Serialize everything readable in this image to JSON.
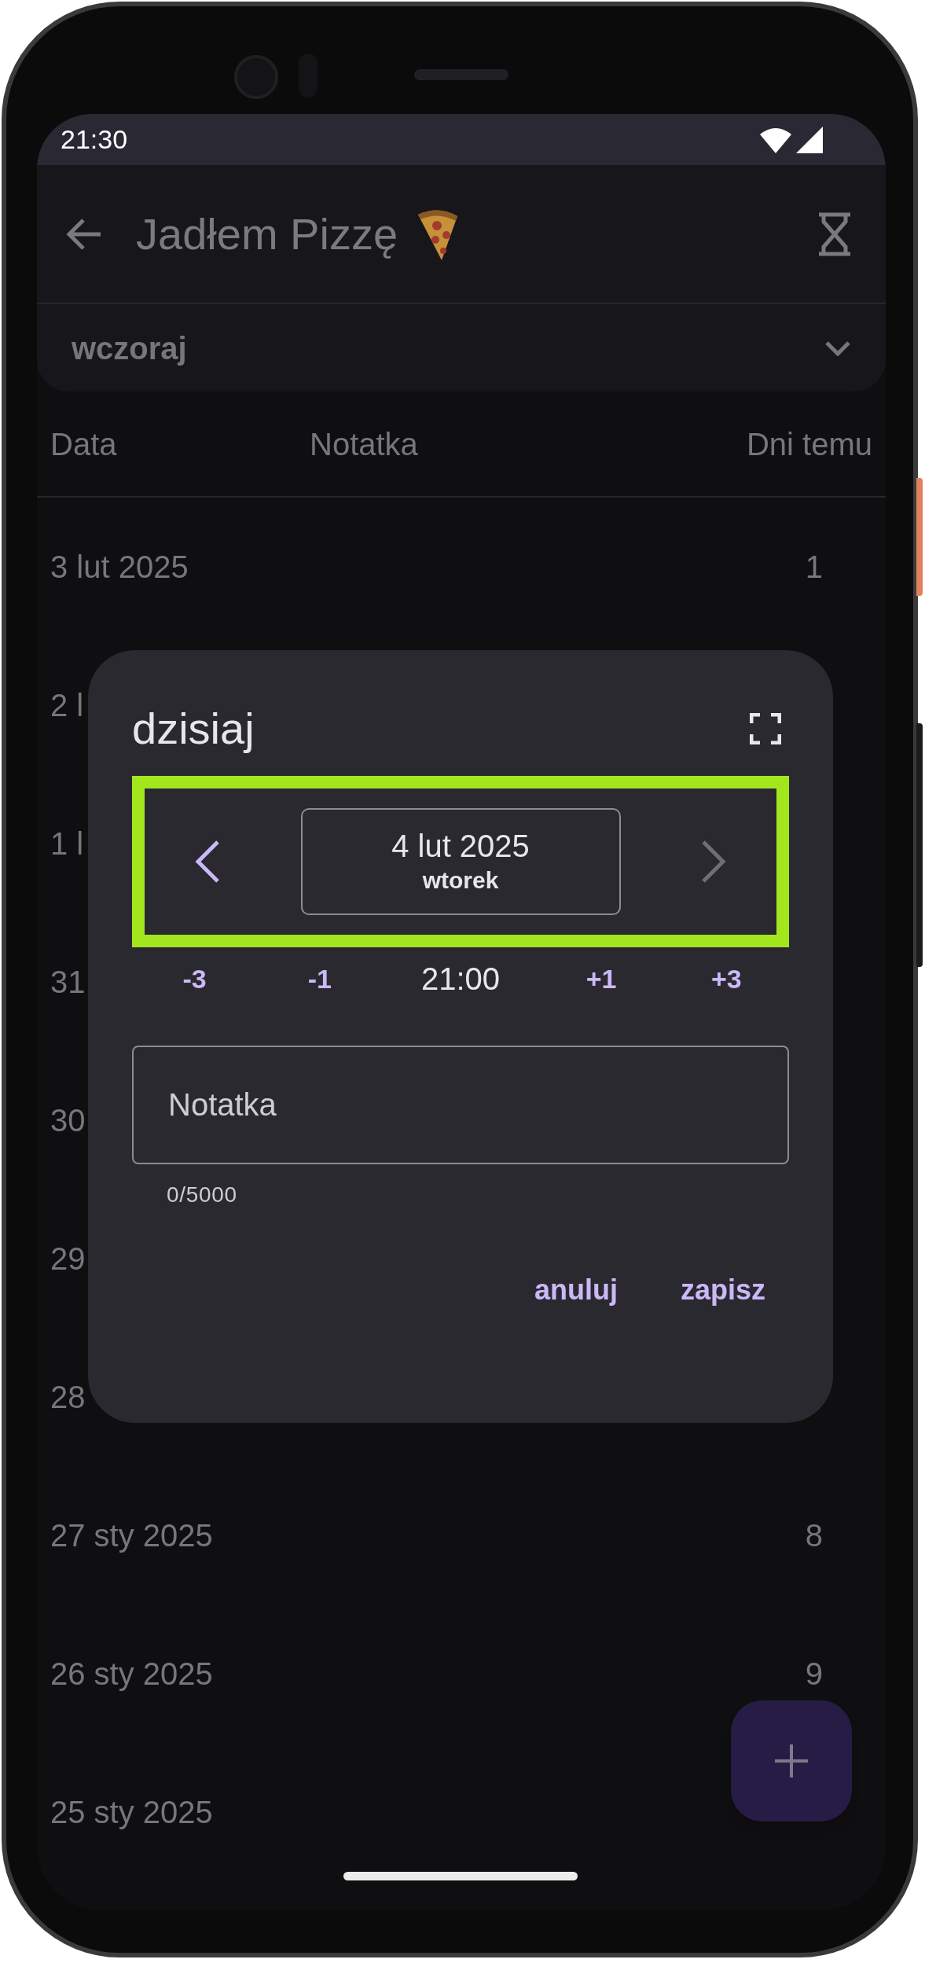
{
  "status_bar": {
    "time": "21:30"
  },
  "app_bar": {
    "title": "Jadłem Pizzę"
  },
  "filter": {
    "value": "wczoraj"
  },
  "table": {
    "columns": [
      "Data",
      "Notatka",
      "Dni temu"
    ],
    "rows": [
      {
        "date": "3 lut 2025",
        "days_ago": "1"
      },
      {
        "date": "2 l"
      },
      {
        "date": "1 l"
      },
      {
        "date": "31"
      },
      {
        "date": "30"
      },
      {
        "date": "29"
      },
      {
        "date": "28"
      },
      {
        "date": "27 sty 2025",
        "days_ago": "8"
      },
      {
        "date": "26 sty 2025",
        "days_ago": "9"
      },
      {
        "date": "25 sty 2025"
      }
    ]
  },
  "dialog": {
    "title": "dzisiaj",
    "date_picker": {
      "highlighted": true,
      "date": "4 lut 2025",
      "weekday": "wtorek",
      "prev_disabled": false,
      "next_disabled": true
    },
    "quick_adjust": [
      {
        "kind": "step",
        "label": "-3"
      },
      {
        "kind": "step",
        "label": "-1"
      },
      {
        "kind": "time",
        "label": "21:00"
      },
      {
        "kind": "step",
        "label": "+1"
      },
      {
        "kind": "step",
        "label": "+3"
      }
    ],
    "note": {
      "placeholder": "Notatka"
    },
    "counter": "0/5000",
    "buttons": [
      "anuluj",
      "zapisz"
    ]
  }
}
